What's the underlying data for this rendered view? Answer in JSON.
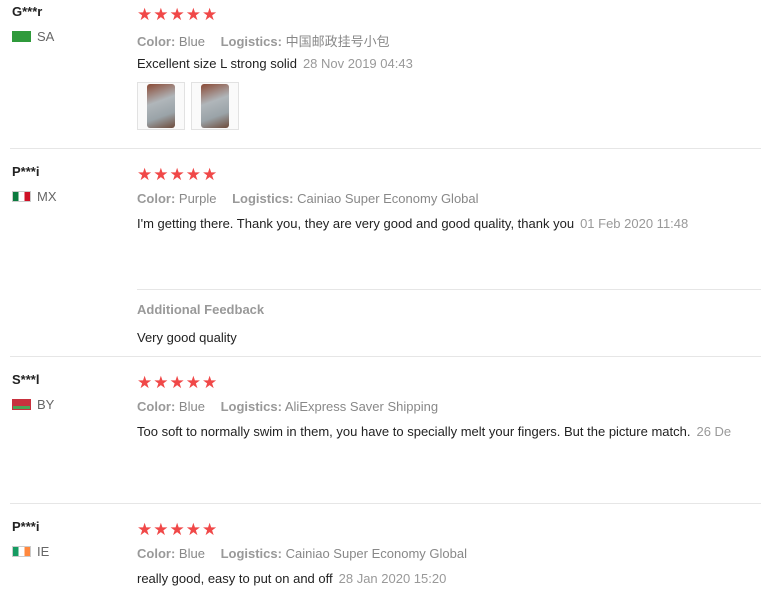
{
  "reviews": [
    {
      "user": "G***r",
      "country": "SA",
      "stars": "★★★★★",
      "color_label": "Color:",
      "color": "Blue",
      "logistics_label": "Logistics:",
      "logistics": "中国邮政挂号小包",
      "text": "Excellent size L strong solid",
      "date": "28 Nov 2019 04:43",
      "photos": 2
    },
    {
      "user": "P***i",
      "country": "MX",
      "stars": "★★★★★",
      "color_label": "Color:",
      "color": "Purple",
      "logistics_label": "Logistics:",
      "logistics": "Cainiao Super Economy Global",
      "text": "I'm getting there. Thank you, they are very good and good quality, thank you",
      "date": "01 Feb 2020 11:48",
      "additional_title": "Additional Feedback",
      "additional_text": "Very good quality"
    },
    {
      "user": "S***l",
      "country": "BY",
      "stars": "★★★★★",
      "color_label": "Color:",
      "color": "Blue",
      "logistics_label": "Logistics:",
      "logistics": "AliExpress Saver Shipping",
      "text": "Too soft to normally swim in them, you have to specially melt your fingers. But the picture match.",
      "date": "26 De"
    },
    {
      "user": "P***i",
      "country": "IE",
      "stars": "★★★★★",
      "color_label": "Color:",
      "color": "Blue",
      "logistics_label": "Logistics:",
      "logistics": "Cainiao Super Economy Global",
      "text": "really good, easy to put on and off",
      "date": "28 Jan 2020 15:20"
    }
  ],
  "flag_colors": {
    "SA": "#2f9a3b",
    "MX": "#0b7a3e",
    "BY": "#c8313e",
    "IE": "#169b62"
  },
  "star_color": "#f04848"
}
